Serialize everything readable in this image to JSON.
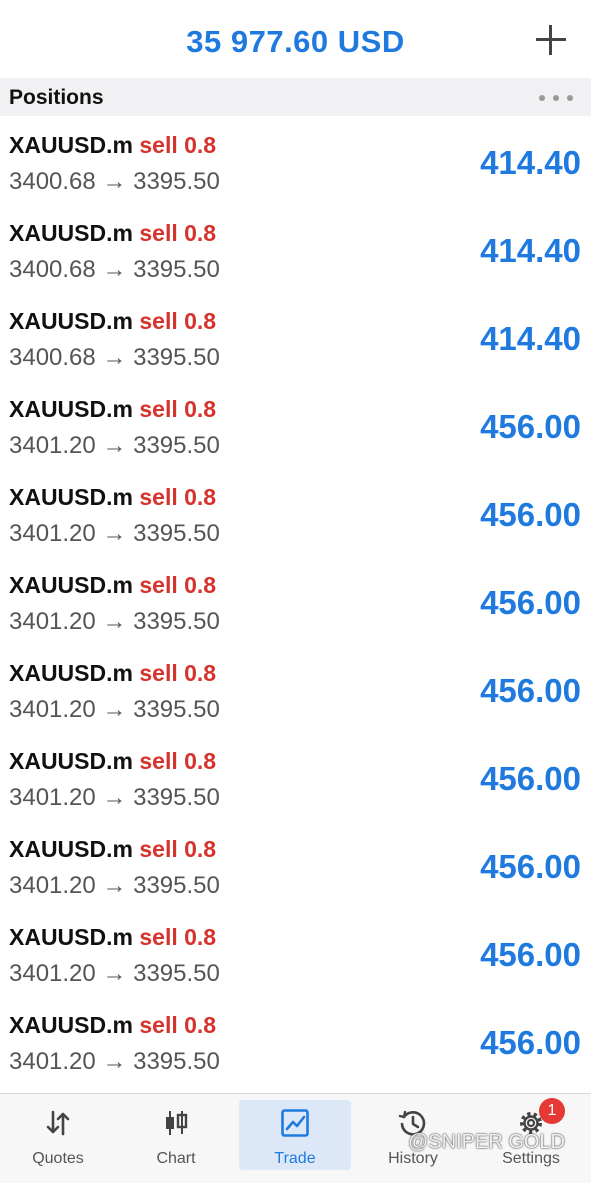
{
  "header": {
    "balance": "35 977.60 USD",
    "add_icon": "plus-icon"
  },
  "section": {
    "title": "Positions",
    "more_icon": "more-dots-icon"
  },
  "positions": [
    {
      "symbol": "XAUUSD.m",
      "side": "sell 0.8",
      "prices": "3400.68 → 3395.50",
      "profit": "414.40"
    },
    {
      "symbol": "XAUUSD.m",
      "side": "sell 0.8",
      "prices": "3400.68 → 3395.50",
      "profit": "414.40"
    },
    {
      "symbol": "XAUUSD.m",
      "side": "sell 0.8",
      "prices": "3400.68 → 3395.50",
      "profit": "414.40"
    },
    {
      "symbol": "XAUUSD.m",
      "side": "sell 0.8",
      "prices": "3401.20 → 3395.50",
      "profit": "456.00"
    },
    {
      "symbol": "XAUUSD.m",
      "side": "sell 0.8",
      "prices": "3401.20 → 3395.50",
      "profit": "456.00"
    },
    {
      "symbol": "XAUUSD.m",
      "side": "sell 0.8",
      "prices": "3401.20 → 3395.50",
      "profit": "456.00"
    },
    {
      "symbol": "XAUUSD.m",
      "side": "sell 0.8",
      "prices": "3401.20 → 3395.50",
      "profit": "456.00"
    },
    {
      "symbol": "XAUUSD.m",
      "side": "sell 0.8",
      "prices": "3401.20 → 3395.50",
      "profit": "456.00"
    },
    {
      "symbol": "XAUUSD.m",
      "side": "sell 0.8",
      "prices": "3401.20 → 3395.50",
      "profit": "456.00"
    },
    {
      "symbol": "XAUUSD.m",
      "side": "sell 0.8",
      "prices": "3401.20 → 3395.50",
      "profit": "456.00"
    },
    {
      "symbol": "XAUUSD.m",
      "side": "sell 0.8",
      "prices": "3401.20 → 3395.50",
      "profit": "456.00"
    }
  ],
  "tabs": [
    {
      "label": "Quotes",
      "icon": "quotes-arrows-icon"
    },
    {
      "label": "Chart",
      "icon": "candlestick-icon"
    },
    {
      "label": "Trade",
      "icon": "trade-chart-icon",
      "active": true
    },
    {
      "label": "History",
      "icon": "history-clock-icon"
    },
    {
      "label": "Settings",
      "icon": "gear-icon",
      "badge": "1"
    }
  ],
  "watermark": "@SNIPER GOLD",
  "colors": {
    "accent": "#1f7ae0",
    "sell": "#d8322e",
    "badge": "#e53935"
  }
}
